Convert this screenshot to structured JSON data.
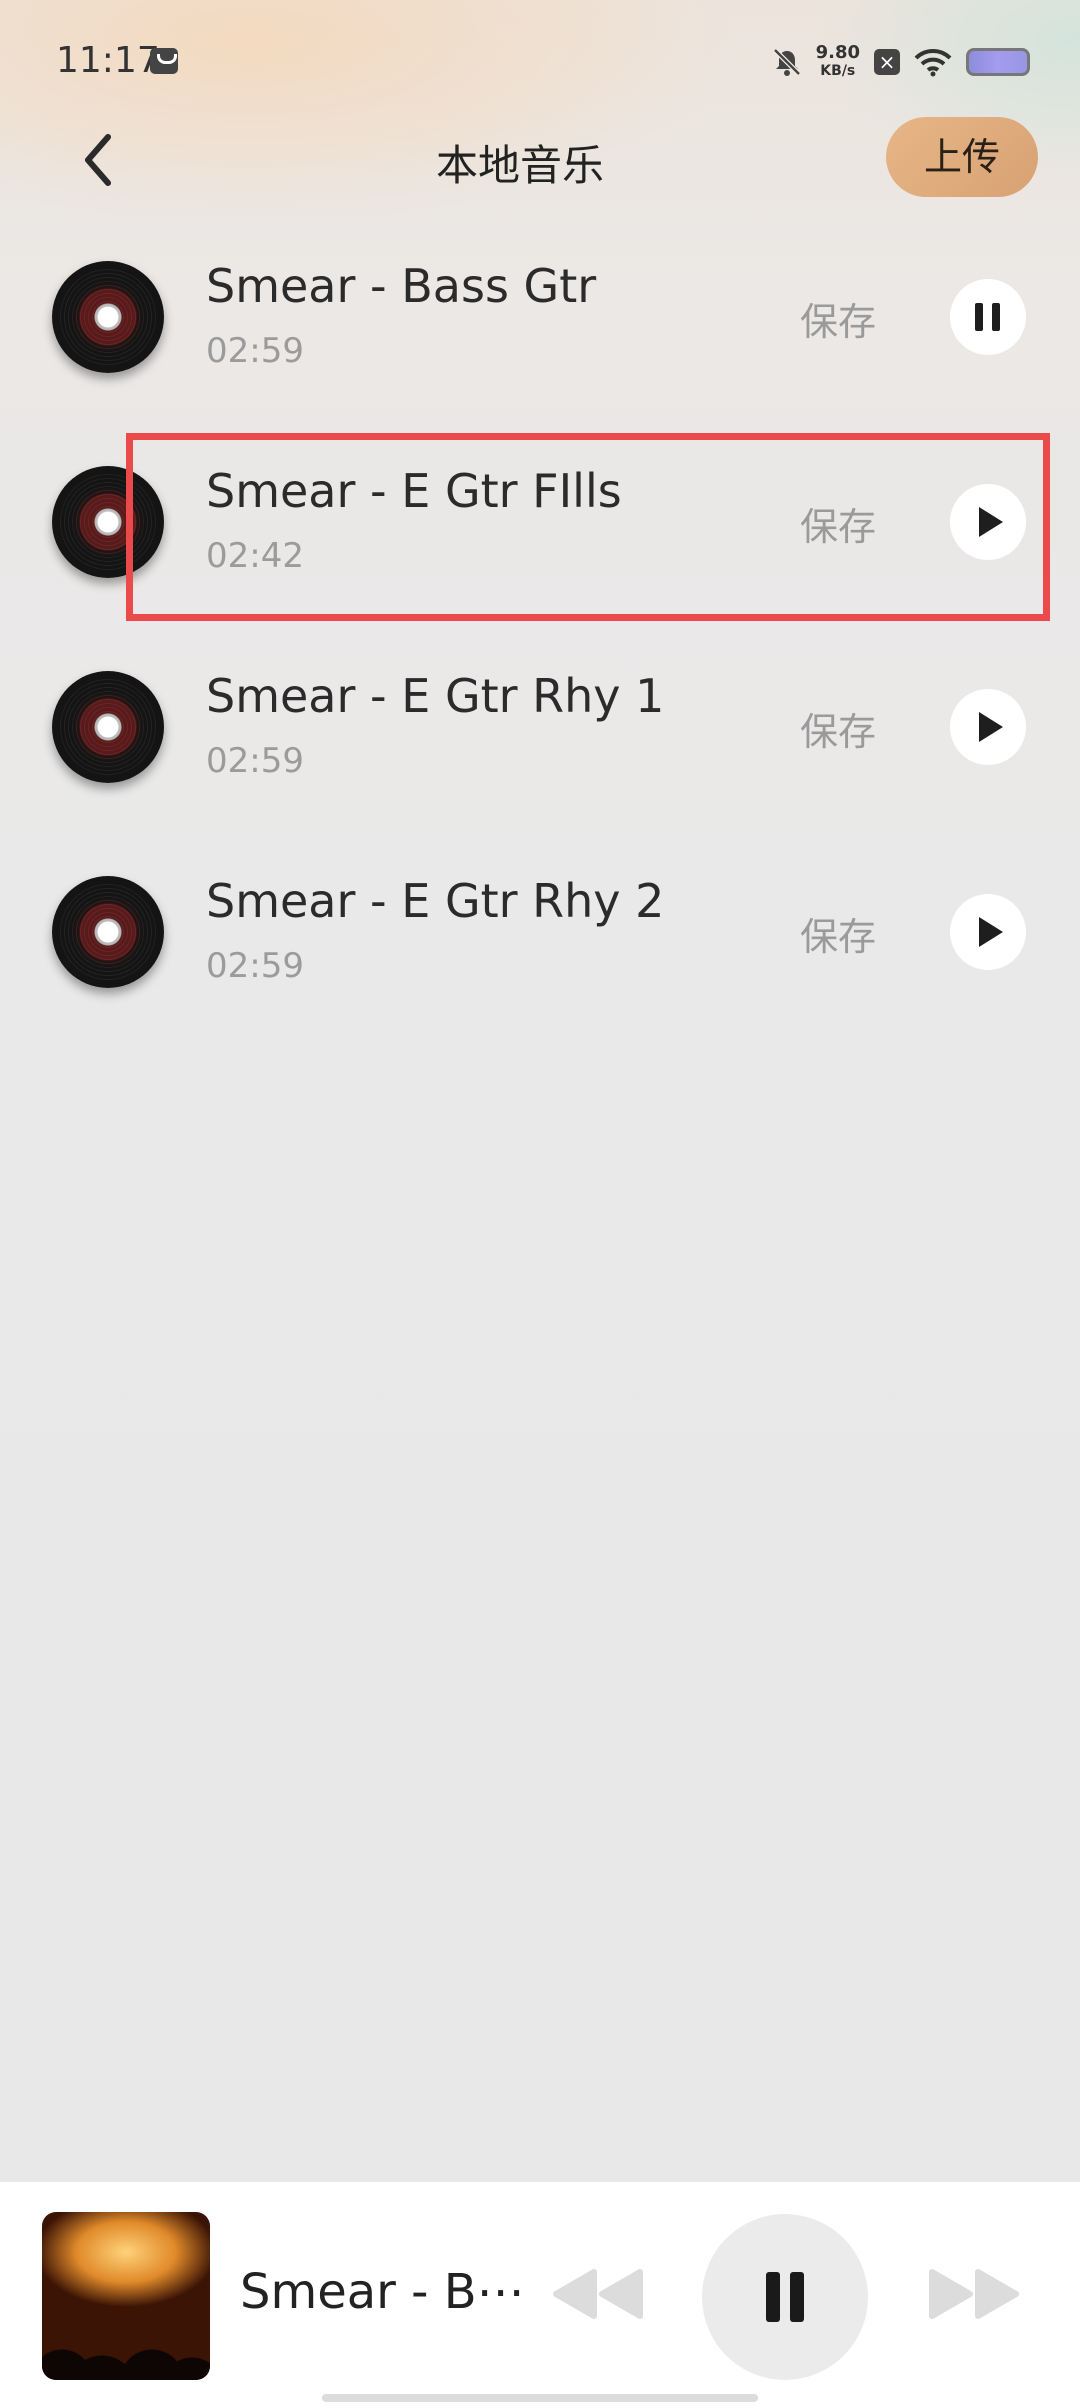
{
  "status_bar": {
    "time": "11:17",
    "speed_value": "9.80",
    "speed_unit": "KB/s"
  },
  "header": {
    "title": "本地音乐",
    "upload_label": "上传"
  },
  "tracks": [
    {
      "title": "Smear - Bass Gtr",
      "duration": "02:59",
      "save_label": "保存",
      "state": "playing"
    },
    {
      "title": "Smear - E Gtr FIlls",
      "duration": "02:42",
      "save_label": "保存",
      "state": "paused"
    },
    {
      "title": "Smear - E Gtr Rhy 1",
      "duration": "02:59",
      "save_label": "保存",
      "state": "paused"
    },
    {
      "title": "Smear - E Gtr Rhy 2",
      "duration": "02:59",
      "save_label": "保存",
      "state": "paused"
    }
  ],
  "player": {
    "title": "Smear - B⋯"
  },
  "colors": {
    "accent": "#dcaa7c",
    "highlight": "#ea4a4a"
  }
}
